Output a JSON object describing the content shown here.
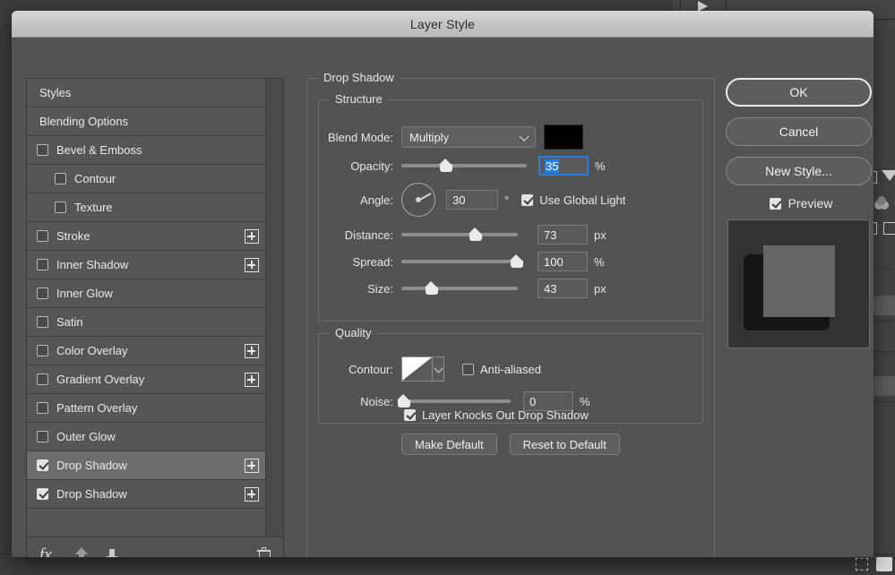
{
  "window": {
    "title": "Layer Style"
  },
  "styles_panel": {
    "items": [
      {
        "label": "Styles",
        "type": "plain",
        "checkbox": null,
        "plus": false
      },
      {
        "label": "Blending Options",
        "type": "plain",
        "checkbox": null,
        "plus": false
      },
      {
        "label": "Bevel & Emboss",
        "type": "normal",
        "checkbox": false,
        "plus": false
      },
      {
        "label": "Contour",
        "type": "indent",
        "checkbox": false,
        "plus": false
      },
      {
        "label": "Texture",
        "type": "indent",
        "checkbox": false,
        "plus": false
      },
      {
        "label": "Stroke",
        "type": "normal",
        "checkbox": false,
        "plus": true
      },
      {
        "label": "Inner Shadow",
        "type": "normal",
        "checkbox": false,
        "plus": true
      },
      {
        "label": "Inner Glow",
        "type": "normal",
        "checkbox": false,
        "plus": false
      },
      {
        "label": "Satin",
        "type": "normal",
        "checkbox": false,
        "plus": false
      },
      {
        "label": "Color Overlay",
        "type": "normal",
        "checkbox": false,
        "plus": true
      },
      {
        "label": "Gradient Overlay",
        "type": "normal",
        "checkbox": false,
        "plus": true
      },
      {
        "label": "Pattern Overlay",
        "type": "normal",
        "checkbox": false,
        "plus": false
      },
      {
        "label": "Outer Glow",
        "type": "normal",
        "checkbox": false,
        "plus": false
      },
      {
        "label": "Drop Shadow",
        "type": "normal",
        "checkbox": true,
        "plus": true,
        "selected": true
      },
      {
        "label": "Drop Shadow",
        "type": "normal",
        "checkbox": true,
        "plus": true
      }
    ],
    "toolbar": {
      "fx_label": "fx",
      "move_up": "move-up",
      "move_down": "move-down",
      "delete": "delete-effect"
    }
  },
  "effect": {
    "group_title": "Drop Shadow",
    "structure": {
      "title": "Structure",
      "blend_mode_label": "Blend Mode:",
      "blend_mode_value": "Multiply",
      "shadow_color": "#000000",
      "opacity_label": "Opacity:",
      "opacity_value": "35",
      "opacity_unit": "%",
      "angle_label": "Angle:",
      "angle_value": "30",
      "angle_unit": "°",
      "use_global_light_label": "Use Global Light",
      "use_global_light_checked": true,
      "distance_label": "Distance:",
      "distance_value": "73",
      "distance_unit": "px",
      "spread_label": "Spread:",
      "spread_value": "100",
      "spread_unit": "%",
      "size_label": "Size:",
      "size_value": "43",
      "size_unit": "px"
    },
    "quality": {
      "title": "Quality",
      "contour_label": "Contour:",
      "contour_preset": "linear-contour",
      "anti_aliased_label": "Anti-aliased",
      "anti_aliased_checked": false,
      "noise_label": "Noise:",
      "noise_value": "0",
      "noise_unit": "%"
    },
    "knockout": {
      "label": "Layer Knocks Out Drop Shadow",
      "checked": true
    },
    "make_default_label": "Make Default",
    "reset_default_label": "Reset to Default"
  },
  "actions": {
    "ok_label": "OK",
    "cancel_label": "Cancel",
    "new_style_label": "New Style...",
    "preview_label": "Preview",
    "preview_checked": true
  },
  "colors": {
    "dialog_bg": "#535353",
    "list_row_bg": "#565656",
    "list_row_selected": "#6d6d6d",
    "accent_blue": "#2a7fdc",
    "titlebar_text": "#2a2a2a"
  }
}
